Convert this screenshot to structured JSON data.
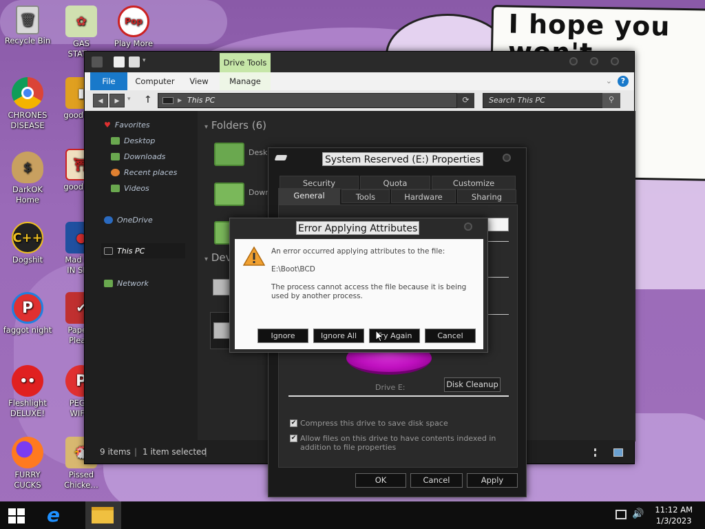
{
  "wallpaper": {
    "note_text": "I hope you\nwon't"
  },
  "desktop_icons": [
    {
      "label": "Recycle Bin",
      "icon": "recycle-bin-icon"
    },
    {
      "label": "GAS\nSTAT…",
      "icon": "gas-station-icon"
    },
    {
      "label": "Play More",
      "icon": "popcap-icon"
    },
    {
      "label": "CHRONES\nDISEASE",
      "icon": "chrome-icon"
    },
    {
      "label": "good g…",
      "icon": "game-icon"
    },
    {
      "label": "DarkOK\nHome",
      "icon": "money-bag-icon"
    },
    {
      "label": "good g…",
      "icon": "game-icon"
    },
    {
      "label": "Dogshit",
      "icon": "cpp-icon"
    },
    {
      "label": "Mad A…\nIN SP…",
      "icon": "angry-birds-icon"
    },
    {
      "label": "faggot night",
      "icon": "p-logo-icon"
    },
    {
      "label": "Pape…\nPlea…",
      "icon": "paper-please-icon"
    },
    {
      "label": "Fleshlight\nDELUXE!",
      "icon": "red-fuzzy-icon"
    },
    {
      "label": "PEG…\nWIF…",
      "icon": "peggle-icon"
    },
    {
      "label": "FURRY\nCUCKS",
      "icon": "firefox-icon"
    },
    {
      "label": "Pissed\nChicke…",
      "icon": "chicken-game-icon"
    }
  ],
  "explorer": {
    "drive_tools": "Drive Tools",
    "ribbon_tabs": [
      "File",
      "Computer",
      "View",
      "Manage"
    ],
    "address": "This PC",
    "search_placeholder": "Search This PC",
    "nav": {
      "favorites": "Favorites",
      "desktop": "Desktop",
      "downloads": "Downloads",
      "recent": "Recent places",
      "videos": "Videos",
      "onedrive": "OneDrive",
      "thispc": "This PC",
      "network": "Network"
    },
    "folders_heading": "Folders (6)",
    "devices_heading": "Dev",
    "folder_labels": [
      "Desk",
      "Down"
    ],
    "status_items": "9 items",
    "status_selected": "1 item selected"
  },
  "properties": {
    "title": "System Reserved (E:) Properties",
    "tabs_row1": [
      "Security",
      "Quota",
      "Customize"
    ],
    "tabs_row2": [
      "General",
      "Tools",
      "Hardware",
      "Sharing"
    ],
    "drive_label": "Drive E:",
    "disk_cleanup": "Disk Cleanup",
    "compress": "Compress this drive to save disk space",
    "index": "Allow files on this drive to have contents indexed in addition to file properties",
    "ok": "OK",
    "cancel": "Cancel",
    "apply": "Apply"
  },
  "error": {
    "title": "Error Applying Attributes",
    "line1": "An error occurred applying attributes to the file:",
    "path": "E:\\Boot\\BCD",
    "line2": "The process cannot access the file because it is being used by another process.",
    "ignore": "Ignore",
    "ignore_all": "Ignore All",
    "try_again": "Try Again",
    "cancel": "Cancel"
  },
  "taskbar": {
    "time": "11:12 AM",
    "date": "1/3/2023"
  },
  "colors": {
    "accent": "#1979ca",
    "drive_tools": "#c6e6a8",
    "folder_green": "#6aa84f",
    "warning": "#f0a030"
  }
}
